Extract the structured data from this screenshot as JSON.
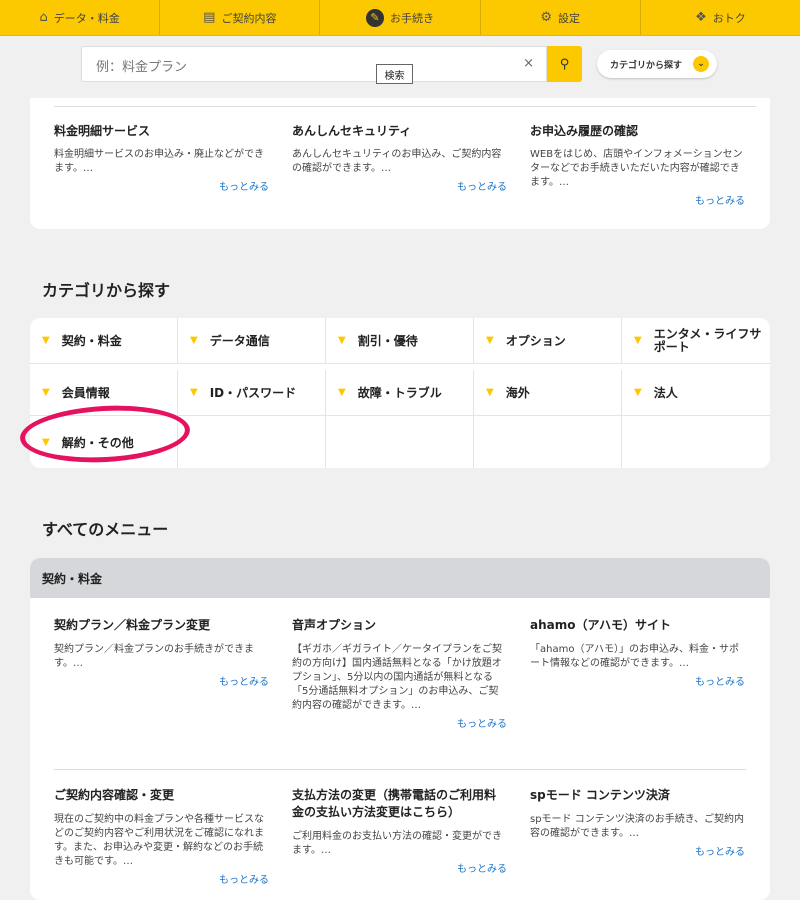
{
  "topnav": [
    {
      "label": "データ・料金",
      "icon": "home-icon"
    },
    {
      "label": "ご契約内容",
      "icon": "document-icon"
    },
    {
      "label": "お手続き",
      "icon": "edit-icon",
      "active": true
    },
    {
      "label": "設定",
      "icon": "gear-icon"
    },
    {
      "label": "おトク",
      "icon": "gift-icon"
    }
  ],
  "search": {
    "placeholder": "例：料金プラン",
    "tooltip": "検索",
    "clear": "×",
    "category_button": "カテゴリから探す"
  },
  "services": [
    {
      "title": "料金明細サービス",
      "desc": "料金明細サービスのお申込み・廃止などができます。…",
      "more": "もっとみる"
    },
    {
      "title": "あんしんセキュリティ",
      "desc": "あんしんセキュリティのお申込み、ご契約内容の確認ができます。…",
      "more": "もっとみる"
    },
    {
      "title": "お申込み履歴の確認",
      "desc": "WEBをはじめ、店頭やインフォメーションセンターなどでお手続きいただいた内容が確認できます。…",
      "more": "もっとみる"
    }
  ],
  "category_heading": "カテゴリから探す",
  "categories": [
    "契約・料金",
    "データ通信",
    "割引・優待",
    "オプション",
    "エンタメ・ライフサポート",
    "会員情報",
    "ID・パスワード",
    "故障・トラブル",
    "海外",
    "法人",
    "解約・その他"
  ],
  "all_menu_heading": "すべてのメニュー",
  "menu": {
    "section": "契約・料金",
    "items": [
      {
        "title": "契約プラン／料金プラン変更",
        "desc": "契約プラン／料金プランのお手続きができます。…",
        "more": "もっとみる"
      },
      {
        "title": "音声オプション",
        "desc": "【ギガホ／ギガライト／ケータイプランをご契約の方向け】国内通話無料となる「かけ放題オプション」、5分以内の国内通話が無料となる「5分通話無料オプション」のお申込み、ご契約内容の確認ができます。…",
        "more": "もっとみる"
      },
      {
        "title": "ahamo（アハモ）サイト",
        "desc": "「ahamo（アハモ）」のお申込み、料金・サポート情報などの確認ができます。…",
        "more": "もっとみる"
      },
      {
        "title": "ご契約内容確認・変更",
        "desc": "現在のご契約中の料金プランや各種サービスなどのご契約内容やご利用状況をご確認になれます。また、お申込みや変更・解約などのお手続きも可能です。…",
        "more": "もっとみる"
      },
      {
        "title": "支払方法の変更（携帯電話のご利用料金の支払い方法変更はこちら）",
        "desc": "ご利用料金のお支払い方法の確認・変更ができます。…",
        "more": "もっとみる"
      },
      {
        "title": "spモード コンテンツ決済",
        "desc": "spモード コンテンツ決済のお手続き、ご契約内容の確認ができます。…",
        "more": "もっとみる"
      }
    ]
  }
}
